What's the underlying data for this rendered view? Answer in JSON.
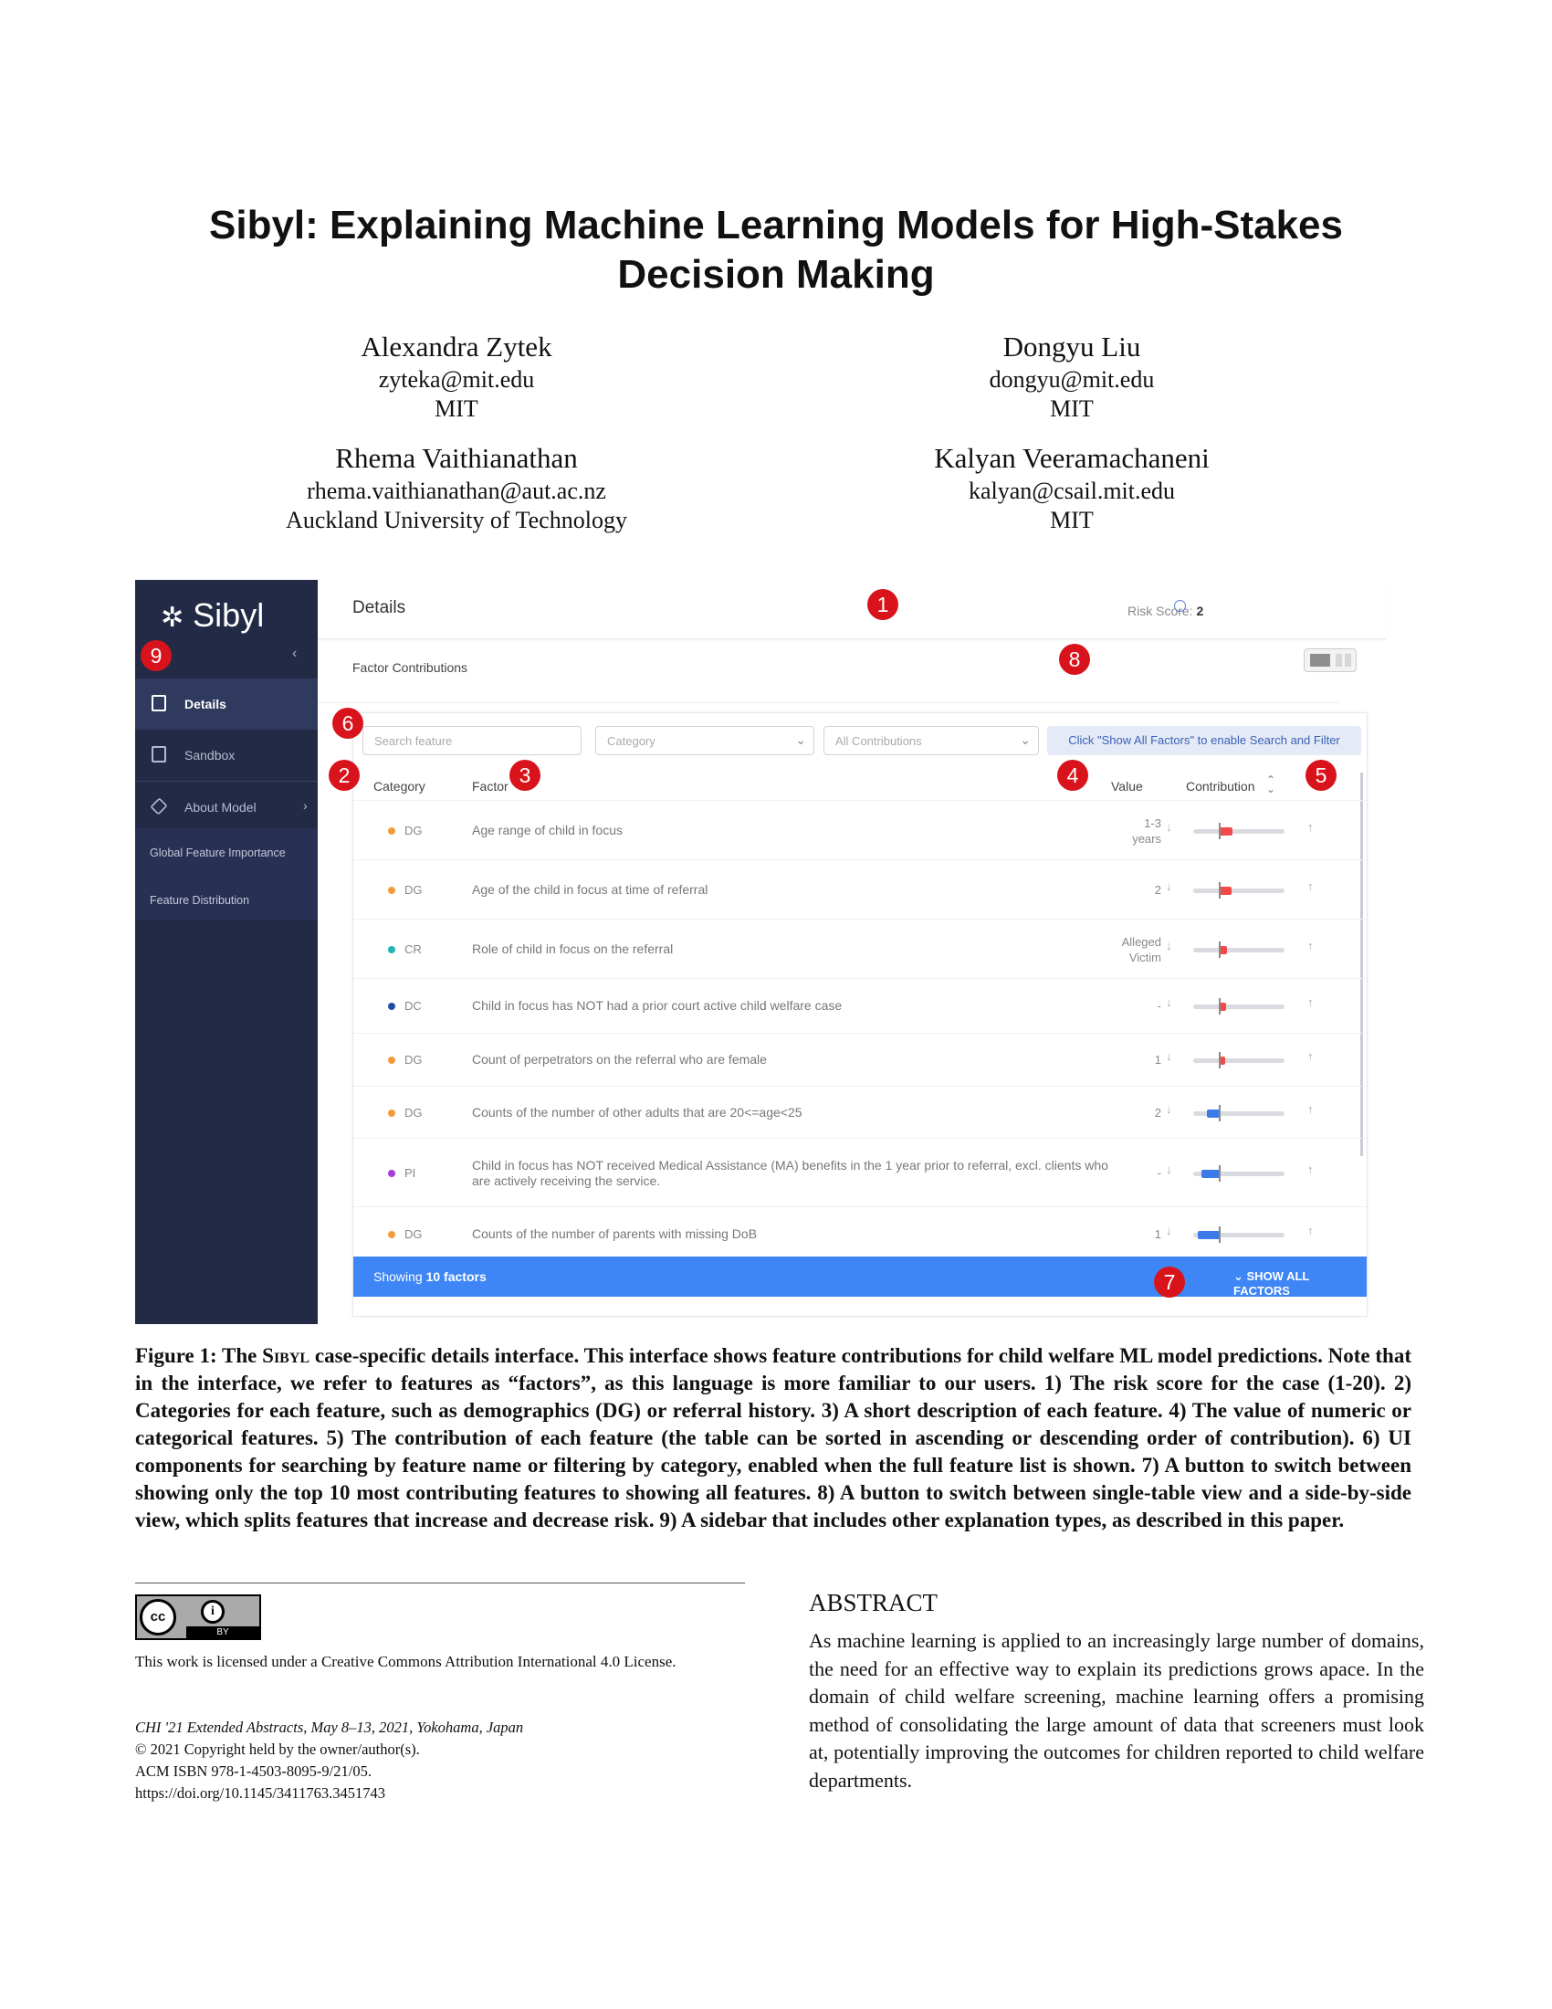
{
  "paper": {
    "title_line1": "Sibyl: Explaining Machine Learning Models for High-Stakes",
    "title_line2": "Decision Making",
    "authors": [
      {
        "name": "Alexandra Zytek",
        "email": "zyteka@mit.edu",
        "affiliation": "MIT"
      },
      {
        "name": "Dongyu Liu",
        "email": "dongyu@mit.edu",
        "affiliation": "MIT"
      },
      {
        "name": "Rhema Vaithianathan",
        "email": "rhema.vaithianathan@aut.ac.nz",
        "affiliation": "Auckland University of Technology"
      },
      {
        "name": "Kalyan Veeramachaneni",
        "email": "kalyan@csail.mit.edu",
        "affiliation": "MIT"
      }
    ]
  },
  "ui": {
    "logo": "Sibyl",
    "collapse_icon": "chevron-left-icon",
    "sidebar": {
      "details": "Details",
      "sandbox": "Sandbox",
      "about_model": "About Model",
      "global_importance": "Global Feature Importance",
      "feature_distribution": "Feature Distribution"
    },
    "header_title": "Details",
    "risk_label": "Risk Score:",
    "risk_value": "2",
    "subheader_title": "Factor Contributions",
    "search_placeholder": "Search feature",
    "category_select": "Category",
    "contributions_select": "All Contributions",
    "enable_hint": "Click \"Show All Factors\" to enable Search and Filter",
    "columns": {
      "category": "Category",
      "factor": "Factor",
      "value": "Value",
      "contribution": "Contribution"
    },
    "rows": [
      {
        "cat": "DG",
        "color": "#f39a3b",
        "factor": "Age range of child in focus",
        "value": "1-3 years",
        "contribution": 0.35
      },
      {
        "cat": "DG",
        "color": "#f39a3b",
        "factor": "Age of the child in focus at time of referral",
        "value": "2",
        "contribution": 0.33
      },
      {
        "cat": "CR",
        "color": "#1fb5b0",
        "factor": "Role of child in focus on the referral",
        "value": "Alleged Victim",
        "contribution": 0.2
      },
      {
        "cat": "DC",
        "color": "#1e4fa8",
        "factor": "Child in focus has NOT had a prior court active child welfare case",
        "value": "-",
        "contribution": 0.17
      },
      {
        "cat": "DG",
        "color": "#f39a3b",
        "factor": "Count of perpetrators on the referral who are female",
        "value": "1",
        "contribution": 0.14
      },
      {
        "cat": "DG",
        "color": "#f39a3b",
        "factor": "Counts of the number of other adults that are 20<=age<25",
        "value": "2",
        "contribution": -0.35
      },
      {
        "cat": "PI",
        "color": "#a53bd9",
        "factor": "Child in focus has NOT received Medical Assistance (MA) benefits in the 1 year prior to referral, excl. clients who are actively receiving the service.",
        "value": "-",
        "contribution": -0.5
      },
      {
        "cat": "DG",
        "color": "#f39a3b",
        "factor": "Counts of the number of parents with missing DoB",
        "value": "1",
        "contribution": -0.6
      }
    ],
    "footer_prefix": "Showing ",
    "footer_count": "10 factors",
    "show_all": "SHOW ALL FACTORS",
    "contribution_colors": {
      "positive": "#f24a4a",
      "negative": "#3b7ae8"
    }
  },
  "badges": [
    "1",
    "2",
    "3",
    "4",
    "5",
    "6",
    "7",
    "8",
    "9"
  ],
  "caption": {
    "label": "Figure 1: The ",
    "sibyl": "Sibyl",
    "text": " case-specific details interface. This interface shows feature contributions for child welfare ML model predictions. Note that in the interface, we refer to features as “factors”, as this language is more familiar to our users. 1) The risk score for the case (1-20). 2) Categories for each feature, such as demographics (DG) or referral history. 3) A short description of each feature. 4) The value of numeric or categorical features. 5) The contribution of each feature (the table can be sorted in ascending or descending order of contribution). 6) UI components for searching by feature name or filtering by category, enabled when the full feature list is shown. 7) A button to switch between showing only the top 10 most contributing features to showing all features. 8) A button to switch between single-table view and a side-by-side view, which splits features that increase and decrease risk. 9) A sidebar that includes other explanation types, as described in this paper."
  },
  "license": {
    "cc_text": "cc",
    "info_text": "i",
    "by_text": "BY",
    "text": "This work is licensed under a Creative Commons Attribution International 4.0 License."
  },
  "meta": {
    "venue": "CHI '21 Extended Abstracts, May 8–13, 2021, Yokohama, Japan",
    "copyright": "© 2021 Copyright held by the owner/author(s).",
    "isbn": "ACM ISBN 978-1-4503-8095-9/21/05.",
    "doi": "https://doi.org/10.1145/3411763.3451743"
  },
  "abstract": {
    "heading": "ABSTRACT",
    "text": "As machine learning is applied to an increasingly large number of domains, the need for an effective way to explain its predictions grows apace. In the domain of child welfare screening, machine learning offers a promising method of consolidating the large amount of data that screeners must look at, potentially improving the outcomes for children reported to child welfare departments."
  }
}
